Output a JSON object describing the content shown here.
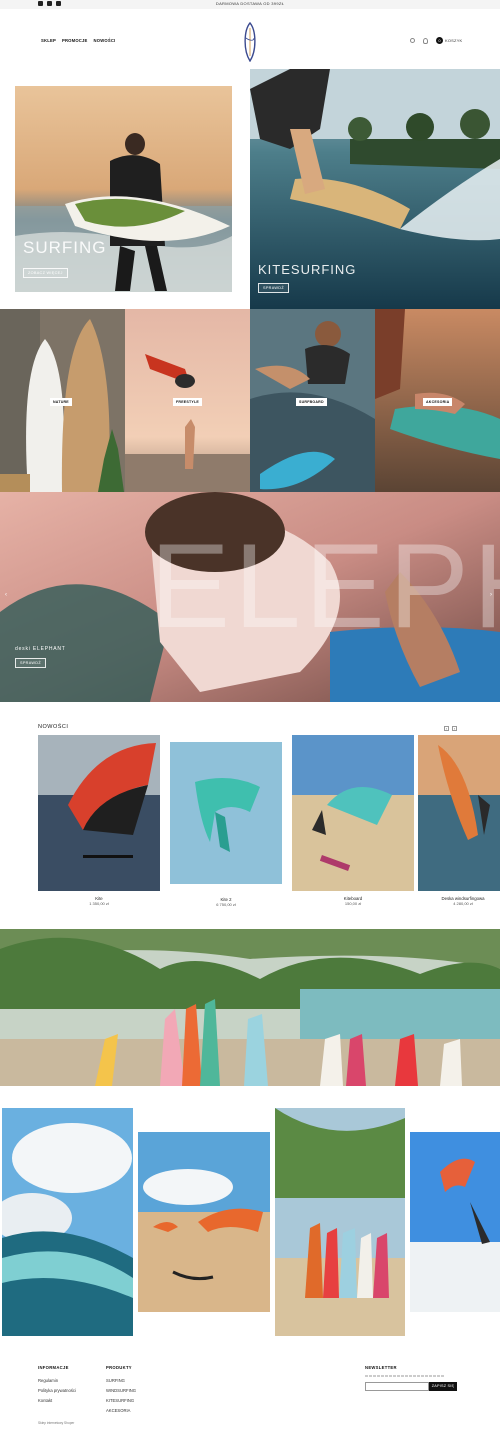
{
  "topbar": {
    "promo": "DARMOWA DOSTAWA OD 399zł",
    "social_icons": [
      "facebook-icon",
      "instagram-icon",
      "youtube-icon"
    ]
  },
  "header": {
    "nav": [
      "SKLEP",
      "PROMOCJE",
      "NOWOŚCI"
    ],
    "cart_count": "0",
    "cart_label": "KOSZYK"
  },
  "hero": {
    "surfing": {
      "title": "SURFING",
      "button": "ZOBACZ WIĘCEJ"
    },
    "kitesurfing": {
      "title": "KITESURFING",
      "button": "SPRAWDŹ"
    }
  },
  "categories": [
    {
      "label": "NATURE"
    },
    {
      "label": "FREESTYLE"
    },
    {
      "label": "SURFBOARD"
    },
    {
      "label": "AKCESORIA"
    }
  ],
  "banner": {
    "big_text": "ELEPHA",
    "label": "deski ELEPHANT",
    "button": "SPRAWDŹ"
  },
  "products": {
    "title": "NOWOŚCI",
    "items": [
      {
        "name": "Kite",
        "price": "1 350,00 zł"
      },
      {
        "name": "Kite 2",
        "price": "6 750,00 zł"
      },
      {
        "name": "Kiteboard",
        "price": "150,00 zł"
      },
      {
        "name": "Deska windsurfingowa",
        "price": "4 280,00 zł"
      }
    ]
  },
  "footer": {
    "info": {
      "title": "INFORMACJE",
      "links": [
        "Regulamin",
        "Polityka prywatności",
        "Kontakt"
      ]
    },
    "products": {
      "title": "PRODUKTY",
      "links": [
        "SURFING",
        "WINDSURFING",
        "KITESURFING",
        "AKCESORIA"
      ]
    },
    "newsletter": {
      "title": "NEWSLETTER",
      "button": "ZAPISZ SIĘ"
    },
    "copyright": "Sklep internetowy Shoper"
  },
  "colors": {
    "accent": "#111111",
    "sea": "#2a6f86",
    "sunset": "#e8b48a"
  }
}
